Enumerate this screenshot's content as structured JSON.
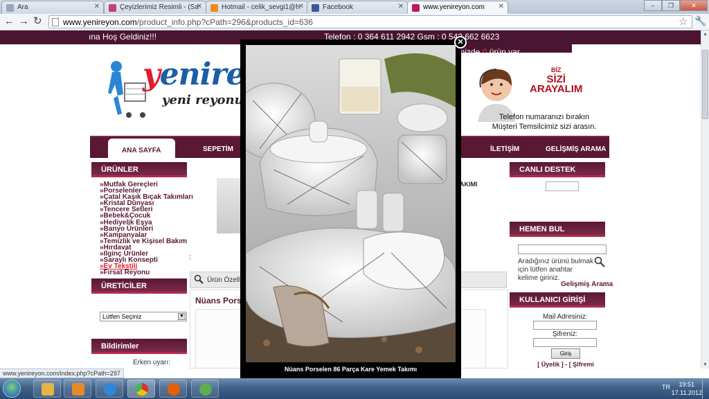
{
  "browser": {
    "tabs": [
      {
        "title": "Ara",
        "color": "#9aa7b8"
      },
      {
        "title": "Çeyizlerimiz Resimli - (Sa",
        "color": "#c1426f"
      },
      {
        "title": "Hotmail - celik_sevgi1@h",
        "color": "#f08b1c"
      },
      {
        "title": "Facebook",
        "color": "#3b5998"
      },
      {
        "title": "www.yenireyon.com",
        "color": "#c0175d"
      }
    ],
    "url_host": "www.yenireyon.com",
    "url_path": "/product_info.php?cPath=296&products_id=636",
    "window_buttons": [
      "–",
      "❐",
      "✕"
    ]
  },
  "site": {
    "welcome": "ına Hoş Geldiniz!!!",
    "phone": "Telefon : 0 364 611 2942  Gsm : 0 542 662 6623",
    "cart_prefix": "inizde",
    "cart_count": "0",
    "cart_suffix": "ürün var.",
    "logo_first": "y",
    "logo_rest": "enirey",
    "tagline": "yeni reyonu",
    "callout_top": "BİZ",
    "callout_mid": "SİZİ",
    "callout_big": "ARAYALIM",
    "callout_text_1": "Telefon numaranızı bırakın",
    "callout_text_2": "Müşteri Temsilcimiz sizi arasın.",
    "menu": [
      "ANA SAYFA",
      "SEPETİM",
      "İLETİŞİM",
      "GELİŞMİŞ ARAMA"
    ],
    "left": {
      "products_title": "ÜRÜNLER",
      "categories": [
        "»Mutfak Gereçleri",
        "»Porselenler",
        "»Çatal Kaşık Bıçak Takımları",
        "»Kristal Dünyası",
        "»Tencere Setleri",
        "»Bebek&Çocuk",
        "»Hediyelik Eşya",
        "»Banyo Ürünleri",
        "»Kampanyalar",
        "»Temizlik ve Kişisel Bakım",
        "»Hırdavat",
        "»Ilginç Ürünler",
        "»Saraylı Konsepti",
        "»Ev Tekstili",
        "»Fırsat Reyonu"
      ],
      "manufacturers_title": "ÜRETİCİLER",
      "select_value": "Lütfen Seçiniz",
      "notifications_title": "Bildirimler",
      "erken": "Erken uyarı:"
    },
    "center": {
      "takimi": "AKIMI",
      "colon": ":",
      "search_tab": "Ürün Özelli",
      "product_title": "Nüans Porse"
    },
    "right": {
      "support_title": "CANLI DESTEK",
      "quickfind_title": "HEMEN BUL",
      "search_help": "Aradığınız ürünü bulmak için lütfen anahtar kelime giriniz.",
      "advanced": "Gelişmiş Arama",
      "login_title": "KULLANICI GİRİŞİ",
      "email_label": "Mail Adresiniz:",
      "password_label": "Şifreniz:",
      "login_button": "Giriş",
      "links": "[ Üyelik ] - [ Şifremi Unuttum? ]"
    }
  },
  "lightbox": {
    "caption": "Nüans Porselen 86 Parça Kare Yemek Takımı",
    "close_symbol": "✕"
  },
  "status_url": "www.yenireyon.com/index.php?cPath=297",
  "taskbar": {
    "lang": "TR",
    "time": "19:51",
    "date": "17.11.2012"
  },
  "colors": {
    "brand": "#4a1530",
    "accent_red": "#e21b2d"
  }
}
